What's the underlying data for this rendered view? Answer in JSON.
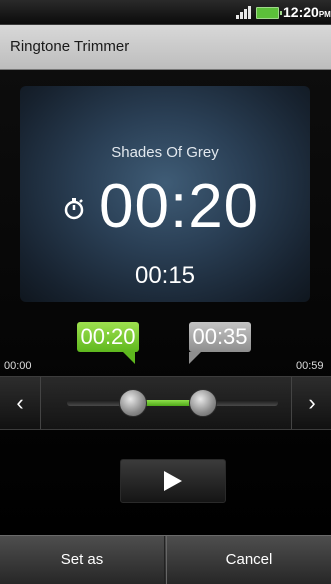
{
  "status_bar": {
    "time": "12:20",
    "ampm": "PM"
  },
  "title_bar": {
    "title": "Ringtone Trimmer"
  },
  "player": {
    "song_title": "Shades Of Grey",
    "elapsed": "00:20",
    "duration": "00:15"
  },
  "trimmer": {
    "start_marker": "00:20",
    "end_marker": "00:35",
    "track_start": "00:00",
    "track_end": "00:59"
  },
  "actions": {
    "set_as": "Set as",
    "cancel": "Cancel"
  },
  "colors": {
    "accent_green": "#6cc82a",
    "panel_blue": "#2a3f55"
  }
}
